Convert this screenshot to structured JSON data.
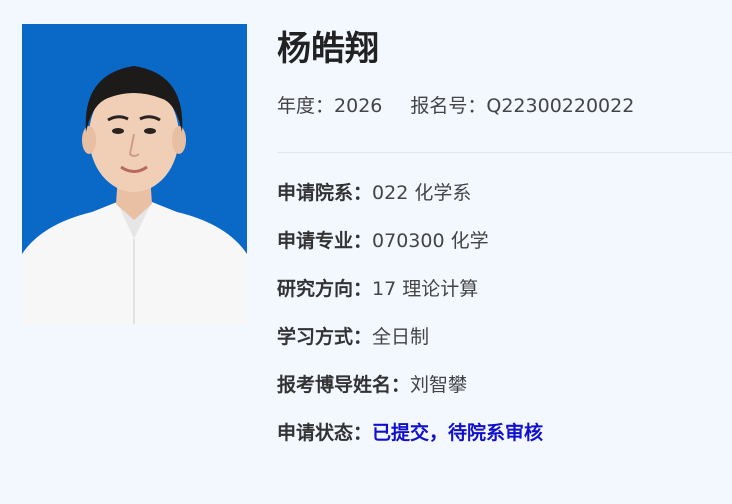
{
  "profile": {
    "name": "杨皓翔",
    "year_label": "年度：",
    "year": "2026",
    "reg_label": "报名号：",
    "reg_no": "Q22300220022",
    "photo_bg": "#0a68c6"
  },
  "fields": [
    {
      "label": "申请院系：",
      "value": "022 化学系"
    },
    {
      "label": "申请专业：",
      "value": "070300 化学"
    },
    {
      "label": "研究方向：",
      "value": "17 理论计算"
    },
    {
      "label": "学习方式：",
      "value": "全日制"
    },
    {
      "label": "报考博导姓名：",
      "value": "刘智攀"
    },
    {
      "label": "申请状态：",
      "value": "已提交，待院系审核",
      "color": "#1010cc"
    }
  ]
}
